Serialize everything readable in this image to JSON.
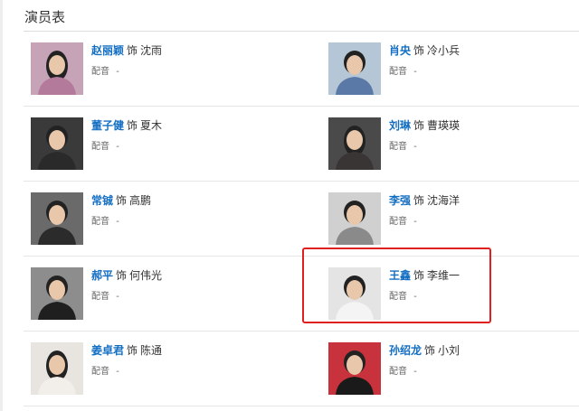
{
  "section": {
    "title": "演员表"
  },
  "cast": [
    {
      "actor": "赵丽颖",
      "role_prefix": "饰",
      "character": "沈雨",
      "dub_label": "配音",
      "dub_value": "-",
      "photo": "actor-photo-female",
      "bg": "#c7a3b8",
      "shirt": "#b47a9b"
    },
    {
      "actor": "肖央",
      "role_prefix": "饰",
      "character": "冷小兵",
      "dub_label": "配音",
      "dub_value": "-",
      "photo": "actor-photo-male",
      "bg": "#b5c7d6",
      "shirt": "#5a79a6"
    },
    {
      "actor": "董子健",
      "role_prefix": "饰",
      "character": "夏木",
      "dub_label": "配音",
      "dub_value": "-",
      "photo": "actor-photo-male",
      "bg": "#3a3a3a",
      "shirt": "#2a2a2a"
    },
    {
      "actor": "刘琳",
      "role_prefix": "饰",
      "character": "曹瑛瑛",
      "dub_label": "配音",
      "dub_value": "-",
      "photo": "actor-photo-female",
      "bg": "#4a4a4a",
      "shirt": "#3a3535"
    },
    {
      "actor": "常铖",
      "role_prefix": "饰",
      "character": "高鹏",
      "dub_label": "配音",
      "dub_value": "-",
      "photo": "actor-photo-male",
      "bg": "#6a6a6a",
      "shirt": "#2b2b2b"
    },
    {
      "actor": "李强",
      "role_prefix": "饰",
      "character": "沈海洋",
      "dub_label": "配音",
      "dub_value": "-",
      "photo": "actor-photo-male",
      "bg": "#d0d0d0",
      "shirt": "#8a8a8a"
    },
    {
      "actor": "郝平",
      "role_prefix": "饰",
      "character": "何伟光",
      "dub_label": "配音",
      "dub_value": "-",
      "photo": "actor-photo-male",
      "bg": "#8d8d8d",
      "shirt": "#1f1f1f"
    },
    {
      "actor": "王鑫",
      "role_prefix": "饰",
      "character": "李维一",
      "dub_label": "配音",
      "dub_value": "-",
      "photo": "actor-photo-male",
      "bg": "#e4e4e4",
      "shirt": "#f4f4f4"
    },
    {
      "actor": "姜卓君",
      "role_prefix": "饰",
      "character": "陈通",
      "dub_label": "配音",
      "dub_value": "-",
      "photo": "actor-photo-female",
      "bg": "#e8e4df",
      "shirt": "#f2eee9"
    },
    {
      "actor": "孙绍龙",
      "role_prefix": "饰",
      "character": "小刘",
      "dub_label": "配音",
      "dub_value": "-",
      "photo": "actor-photo-male",
      "bg": "#c8323c",
      "shirt": "#1a1a1a"
    }
  ],
  "colors": {
    "link": "#136ec2",
    "highlight": "#e02020",
    "divider": "#e6e6e6"
  }
}
